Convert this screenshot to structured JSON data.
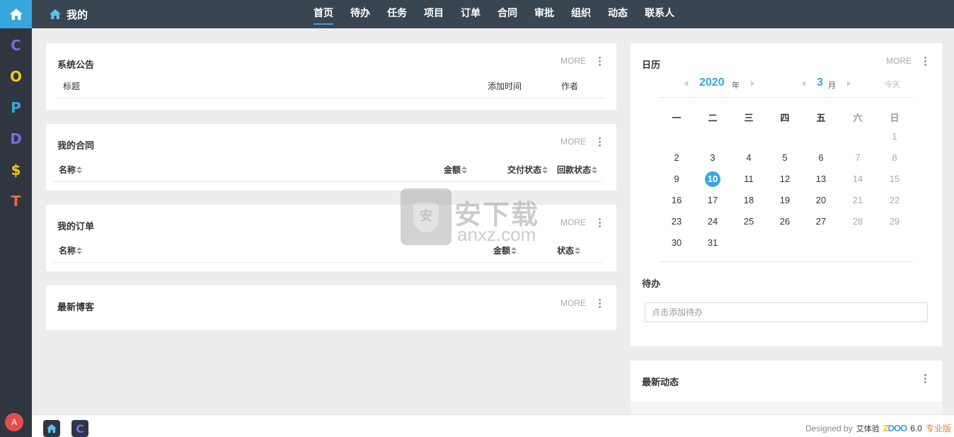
{
  "rail": {
    "apps": [
      {
        "letter": "C",
        "color": "#6f6fe6"
      },
      {
        "letter": "O",
        "color": "#f5c518"
      },
      {
        "letter": "P",
        "color": "#35a7dd"
      },
      {
        "letter": "D",
        "color": "#6f6fe6"
      },
      {
        "letter": "$",
        "color": "#f5c518"
      },
      {
        "letter": "T",
        "color": "#e96a3c"
      }
    ],
    "avatar": "A"
  },
  "header": {
    "title": "我的",
    "nav": [
      "首页",
      "待办",
      "任务",
      "项目",
      "订单",
      "合同",
      "审批",
      "组织",
      "动态",
      "联系人"
    ],
    "active_index": 0
  },
  "panels": {
    "more": "MORE",
    "announcement": {
      "title": "系统公告",
      "cols": [
        "标题",
        "添加时间",
        "作者"
      ]
    },
    "contracts": {
      "title": "我的合同",
      "cols": [
        "名称",
        "金额",
        "交付状态",
        "回款状态"
      ]
    },
    "orders": {
      "title": "我的订单",
      "cols": [
        "名称",
        "金额",
        "状态"
      ]
    },
    "blog": {
      "title": "最新博客"
    }
  },
  "calendar": {
    "title": "日历",
    "year": "2020",
    "year_unit": "年",
    "month": "3",
    "month_unit": "月",
    "today_label": "今天",
    "weekdays": [
      "一",
      "二",
      "三",
      "四",
      "五",
      "六",
      "日"
    ],
    "today": 10
  },
  "todo": {
    "title": "待办",
    "placeholder": "点击添加待办"
  },
  "activity": {
    "title": "最新动态"
  },
  "watermark": {
    "text": "安下载",
    "url": "anxz.com"
  },
  "footer": {
    "designed_by": "Designed by",
    "brand": "艾体验",
    "logo": {
      "z": "Z",
      "rest": "DOO"
    },
    "version": "6.0",
    "edition": "专业版"
  },
  "colors": {
    "accent": "#35a7dd",
    "rail": "#2f3640",
    "topbar": "#3a4552",
    "avatar": "#e54c4c"
  }
}
